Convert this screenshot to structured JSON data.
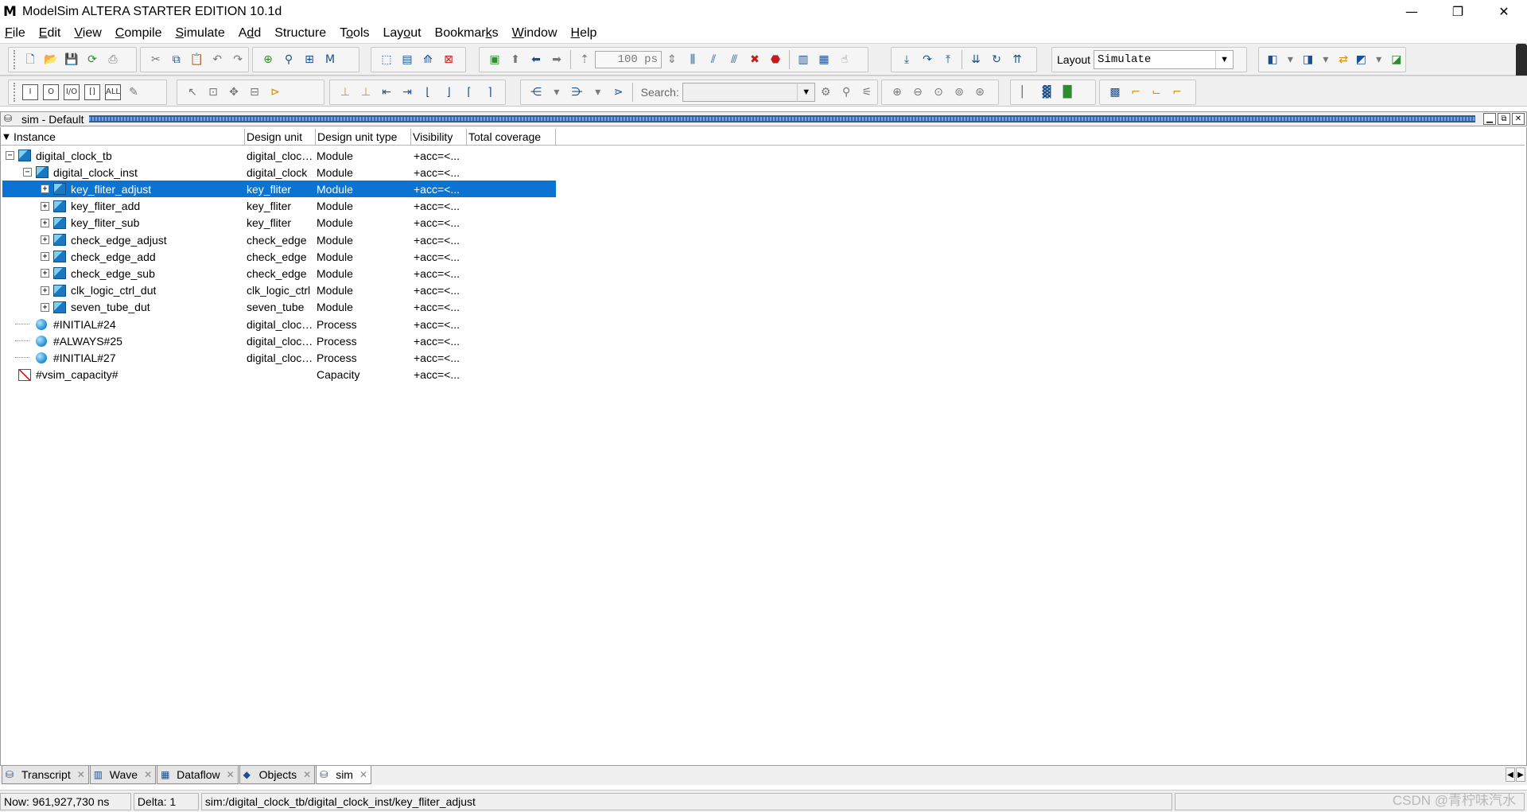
{
  "window": {
    "title": "ModelSim ALTERA STARTER EDITION 10.1d",
    "logo": "M",
    "minimize": "—",
    "restore": "❐",
    "close": "✕"
  },
  "menu": [
    {
      "mnemonic": "F",
      "rest": "ile"
    },
    {
      "mnemonic": "E",
      "rest": "dit"
    },
    {
      "mnemonic": "V",
      "rest": "iew"
    },
    {
      "mnemonic": "C",
      "rest": "ompile"
    },
    {
      "mnemonic": "S",
      "rest": "imulate"
    },
    {
      "pre": "A",
      "mnemonic": "d",
      "rest": "d"
    },
    {
      "pre": "Structure",
      "mnemonic": "",
      "rest": ""
    },
    {
      "pre": "T",
      "mnemonic": "o",
      "rest": "ols"
    },
    {
      "pre": "Lay",
      "mnemonic": "o",
      "rest": "ut"
    },
    {
      "pre": "Bookmar",
      "mnemonic": "k",
      "rest": "s"
    },
    {
      "mnemonic": "W",
      "rest": "indow"
    },
    {
      "mnemonic": "H",
      "rest": "elp"
    }
  ],
  "toolbar": {
    "run_length": "100 ps",
    "layout_label": "Layout",
    "layout_value": "Simulate",
    "search_label": "Search:",
    "search_value": ""
  },
  "panel": {
    "title": "sim - Default"
  },
  "table": {
    "columns": [
      "Instance",
      "Design unit",
      "Design unit type",
      "Visibility",
      "Total coverage"
    ],
    "rows": [
      {
        "instance": "digital_clock_tb",
        "unit": "digital_clock...",
        "type": "Module",
        "vis": "+acc=<..."
      },
      {
        "instance": "digital_clock_inst",
        "unit": "digital_clock",
        "type": "Module",
        "vis": "+acc=<..."
      },
      {
        "instance": "key_fliter_adjust",
        "unit": "key_fliter",
        "type": "Module",
        "vis": "+acc=<..."
      },
      {
        "instance": "key_fliter_add",
        "unit": "key_fliter",
        "type": "Module",
        "vis": "+acc=<..."
      },
      {
        "instance": "key_fliter_sub",
        "unit": "key_fliter",
        "type": "Module",
        "vis": "+acc=<..."
      },
      {
        "instance": "check_edge_adjust",
        "unit": "check_edge",
        "type": "Module",
        "vis": "+acc=<..."
      },
      {
        "instance": "check_edge_add",
        "unit": "check_edge",
        "type": "Module",
        "vis": "+acc=<..."
      },
      {
        "instance": "check_edge_sub",
        "unit": "check_edge",
        "type": "Module",
        "vis": "+acc=<..."
      },
      {
        "instance": "clk_logic_ctrl_dut",
        "unit": "clk_logic_ctrl",
        "type": "Module",
        "vis": "+acc=<..."
      },
      {
        "instance": "seven_tube_dut",
        "unit": "seven_tube",
        "type": "Module",
        "vis": "+acc=<..."
      },
      {
        "instance": "#INITIAL#24",
        "unit": "digital_clock...",
        "type": "Process",
        "vis": "+acc=<..."
      },
      {
        "instance": "#ALWAYS#25",
        "unit": "digital_clock...",
        "type": "Process",
        "vis": "+acc=<..."
      },
      {
        "instance": "#INITIAL#27",
        "unit": "digital_clock...",
        "type": "Process",
        "vis": "+acc=<..."
      },
      {
        "instance": "#vsim_capacity#",
        "unit": "",
        "type": "Capacity",
        "vis": "+acc=<..."
      }
    ]
  },
  "tabs": [
    {
      "label": "Transcript",
      "icon": "transcript-icon"
    },
    {
      "label": "Wave",
      "icon": "wave-icon"
    },
    {
      "label": "Dataflow",
      "icon": "dataflow-icon"
    },
    {
      "label": "Objects",
      "icon": "objects-icon"
    },
    {
      "label": "sim",
      "icon": "sim-icon"
    }
  ],
  "status": {
    "now": "Now: 961,927,730 ns",
    "delta": "Delta: 1",
    "path": "sim:/digital_clock_tb/digital_clock_inst/key_fliter_adjust"
  },
  "watermark": "CSDN @青柠味汽水",
  "colors": {
    "selection": "#0b74d3",
    "module_icon": "#1a78c2",
    "panel_stripe": "#2c5c9f"
  }
}
